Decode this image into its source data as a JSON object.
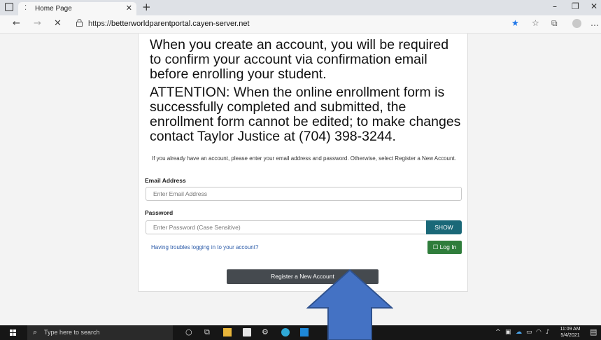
{
  "browser": {
    "tab_title": "Home Page",
    "tab_dots": "⁚",
    "new_tab": "+",
    "url_prefix": "https://",
    "url_host": "betterworldparentportal.cayen-server.net",
    "icons": [
      "window-menu-icon",
      "back-icon",
      "forward-icon",
      "close-icon",
      "lock-icon",
      "favorite-star-icon",
      "favorites-list-icon",
      "collections-icon",
      "profile-icon",
      "more-icon",
      "minimize-icon",
      "maximize-icon",
      "window-close-icon"
    ]
  },
  "page": {
    "notice1": "When you create an account, you will be required to confirm your account via confirmation email before enrolling your student.",
    "notice2": "ATTENTION:  When the online enrollment form is successfully completed and submitted, the enrollment form cannot be edited; to make changes contact Taylor Justice at (704) 398-3244.",
    "instructions": "If you already have an account, please enter your email address and password. Otherwise, select Register a New Account.",
    "email_label": "Email Address",
    "email_placeholder": "Enter Email Address",
    "password_label": "Password",
    "password_placeholder": "Enter Password (Case Sensitive)",
    "show_label": "SHOW",
    "trouble_link": "Having troubles logging in to your account?",
    "login_label": "☐ Log In",
    "register_label": "Register a New Account"
  },
  "taskbar": {
    "search_placeholder": "Type here to search",
    "time": "11:09 AM",
    "date": "5/4/2021"
  },
  "colors": {
    "show_button": "#1a6878",
    "login_button": "#2f7d3b",
    "register_button": "#454a4f",
    "arrow_fill": "#4472c4",
    "arrow_stroke": "#2f528f",
    "favorite_star": "#1a73e8"
  }
}
